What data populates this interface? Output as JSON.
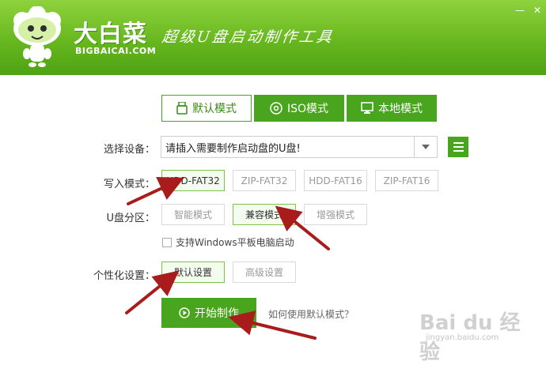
{
  "header": {
    "brand_title": "大白菜",
    "brand_url": "BIGBAICAI.COM",
    "slogan": "超级U盘启动制作工具"
  },
  "tabs": [
    {
      "label": "默认模式",
      "icon": "u-disk-icon",
      "active": true
    },
    {
      "label": "ISO模式",
      "icon": "disc-icon",
      "active": false
    },
    {
      "label": "本地模式",
      "icon": "monitor-icon",
      "active": false
    }
  ],
  "device": {
    "label": "选择设备：",
    "value": "请插入需要制作启动盘的U盘!"
  },
  "write_mode": {
    "label": "写入模式：",
    "options": [
      "HDD-FAT32",
      "ZIP-FAT32",
      "HDD-FAT16",
      "ZIP-FAT16"
    ],
    "selected": "HDD-FAT32"
  },
  "partition": {
    "label": "U盘分区：",
    "options": [
      "智能模式",
      "兼容模式",
      "增强模式"
    ],
    "selected": "兼容模式",
    "checkbox_label": "支持Windows平板电脑启动"
  },
  "personalize": {
    "label": "个性化设置：",
    "options": [
      "默认设置",
      "高级设置"
    ],
    "selected": "默认设置"
  },
  "start_button": "开始制作",
  "help_link": "如何使用默认模式？",
  "watermark": {
    "brand": "Bai du 经验",
    "url": "jingyan.baidu.com"
  },
  "colors": {
    "accent": "#4aa51e",
    "header_top": "#8fd23d",
    "arrow": "#a81c1c"
  }
}
